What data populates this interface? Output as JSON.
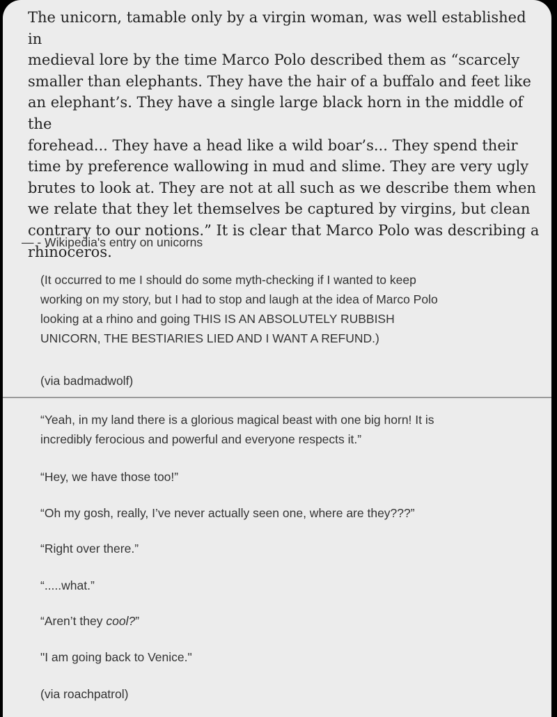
{
  "post": {
    "quote": "The unicorn, tamable only by a virgin woman, was well established in\nmedieval lore by the time Marco Polo described them as “scarcely\nsmaller than elephants. They have the hair of a buffalo and feet like\nan elephant’s. They have a single large black horn in the middle of the\nforehead... They have a head like a wild boar’s... They spend their\ntime by preference wallowing in mud and slime. They are very ugly\nbrutes to look at. They are not at all such as we describe them when\nwe relate that they let themselves be captured by virgins, but clean\ncontrary to our notions.” It is clear that Marco Polo was describing a\nrhinoceros.",
    "attribution": "— - Wikipedia's entry on unicorns",
    "comment1": "(It occurred to me I should do some myth-checking if I wanted to keep\nworking on my story, but I had to stop and laugh at the idea of Marco Polo\nlooking at a rhino and going THIS IS AN ABSOLUTELY RUBBISH\nUNICORN, THE BESTIARIES LIED AND I WANT A REFUND.)",
    "via1": "(via badmadwolf)",
    "comment2_first": "“Yeah, in my land there is a glorious magical beast with one big horn! It is\nincredibly ferocious and powerful and everyone respects it.”",
    "line_hey": "“Hey, we have those too!”",
    "line_gosh": "“Oh my gosh, really, I’ve never actually seen one, where are they???”",
    "line_right": "“Right over there.”",
    "line_what": "“.....what.”",
    "line_arent_prefix": "“Aren’t they ",
    "line_arent_cool": "cool?",
    "line_arent_suffix": "”",
    "line_venice": "\"I am going back to Venice.\"",
    "via2": "(via roachpatrol)"
  },
  "colors": {
    "card_background": "#ececec",
    "page_background": "#000000",
    "text": "#222222",
    "divider": "#9a9a9a"
  }
}
